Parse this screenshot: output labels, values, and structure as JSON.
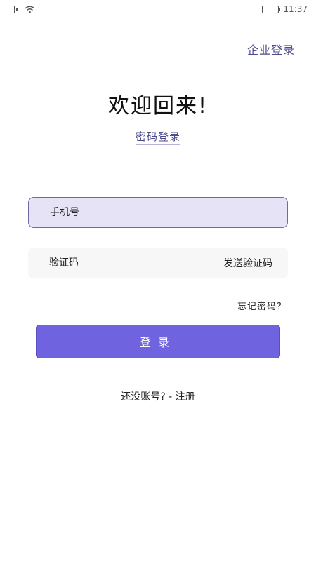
{
  "status_bar": {
    "time": "11:37",
    "icons": [
      "sim-icon",
      "wifi-icon",
      "battery-icon"
    ]
  },
  "header": {
    "enterprise_login": "企业登录"
  },
  "welcome": {
    "title": "欢迎回来!",
    "password_login": "密码登录"
  },
  "form": {
    "phone_placeholder": "手机号",
    "code_placeholder": "验证码",
    "send_code_label": "发送验证码",
    "forgot_password": "忘记密码？",
    "login_label": "登录"
  },
  "footer": {
    "register_prompt": "还没账号? - 注册"
  },
  "colors": {
    "accent": "#6f63e0",
    "link": "#4e4b8c",
    "phone_field_bg": "#e6e3f7",
    "code_field_bg": "#f7f7f7"
  }
}
